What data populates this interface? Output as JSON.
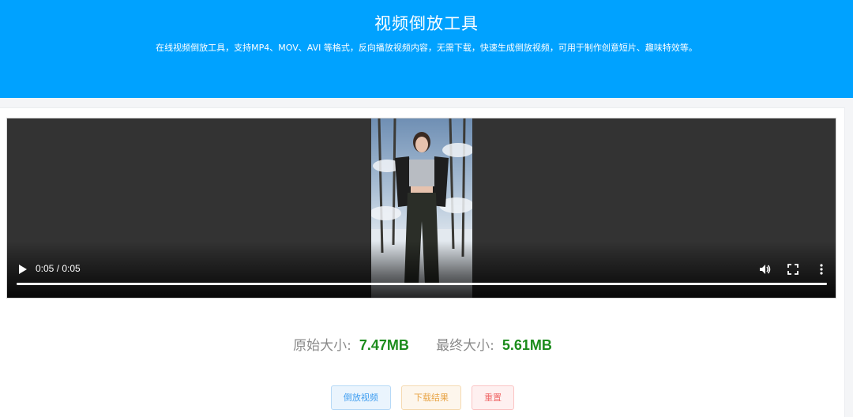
{
  "header": {
    "title": "视频倒放工具",
    "description": "在线视频倒放工具，支持MP4、MOV、AVI 等格式，反向播放视频内容，无需下载，快速生成倒放视频，可用于制作创意短片、趣味特效等。"
  },
  "player": {
    "time_display": "0:05 / 0:05",
    "progress": 1.0
  },
  "sizes": {
    "original_label": "原始大小:",
    "original_value": "7.47MB",
    "final_label": "最终大小:",
    "final_value": "5.61MB"
  },
  "actions": {
    "reverse_label": "倒放视频",
    "download_label": "下载结果",
    "reset_label": "重置"
  },
  "colors": {
    "header_bg": "#00a2ff",
    "size_value": "#1c8c1c"
  },
  "icons": [
    "play-icon",
    "volume-icon",
    "fullscreen-icon",
    "more-options-icon"
  ]
}
